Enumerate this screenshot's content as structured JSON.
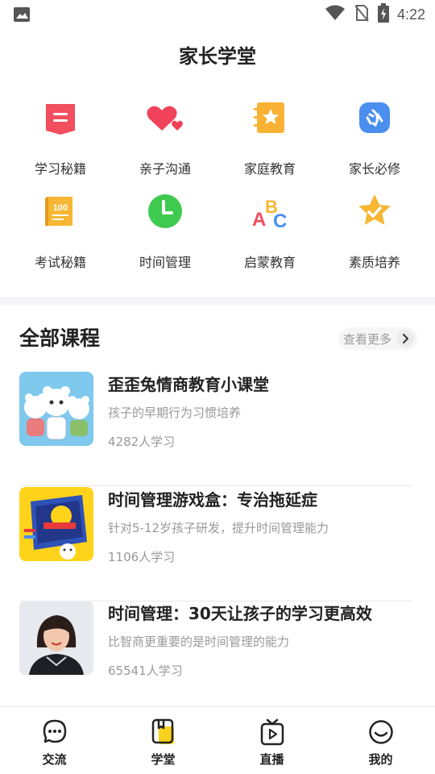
{
  "status_bar": {
    "time": "4:22",
    "icons": [
      "image-icon",
      "wifi-icon",
      "no-sim-icon",
      "battery-charging-icon"
    ]
  },
  "page": {
    "title": "家长学堂"
  },
  "categories": [
    {
      "label": "学习秘籍",
      "icon": "book-icon",
      "color": "#f24e5e"
    },
    {
      "label": "亲子沟通",
      "icon": "hearts-icon",
      "color": "#f0425a"
    },
    {
      "label": "家庭教育",
      "icon": "star-notebook-icon",
      "color": "#f9b234"
    },
    {
      "label": "家长必修",
      "icon": "required-badge-icon",
      "color": "#4a8ff0"
    },
    {
      "label": "考试秘籍",
      "icon": "exam-score-icon",
      "color": "#f7b733"
    },
    {
      "label": "时间管理",
      "icon": "clock-icon",
      "color": "#3ec94f"
    },
    {
      "label": "启蒙教育",
      "icon": "abc-icon",
      "color": "#f24e5e"
    },
    {
      "label": "素质培养",
      "icon": "star-check-icon",
      "color": "#f7b733"
    }
  ],
  "courses_section": {
    "title": "全部课程",
    "more_label": "查看更多"
  },
  "courses": [
    {
      "title": "歪歪兔情商教育小课堂",
      "desc": "孩子的早期行为习惯培养",
      "count": "4282人学习",
      "thumb": "cartoon-bears-thumbnail"
    },
    {
      "title": "时间管理游戏盒：专治拖延症",
      "desc": "针对5-12岁孩子研发，提升时间管理能力",
      "count": "1106人学习",
      "thumb": "game-box-thumbnail"
    },
    {
      "title": "时间管理：30天让孩子的学习更高效",
      "desc": "比智商更重要的是时间管理的能力",
      "count": "65541人学习",
      "thumb": "instructor-portrait-thumbnail"
    }
  ],
  "bottom_nav": [
    {
      "label": "交流",
      "icon": "chat-bubble-icon",
      "active": false
    },
    {
      "label": "学堂",
      "icon": "school-book-icon",
      "active": true
    },
    {
      "label": "直播",
      "icon": "live-tv-icon",
      "active": false
    },
    {
      "label": "我的",
      "icon": "smile-profile-icon",
      "active": false
    }
  ],
  "colors": {
    "accent": "#f7d21d",
    "text": "#222222",
    "muted": "#999999"
  }
}
